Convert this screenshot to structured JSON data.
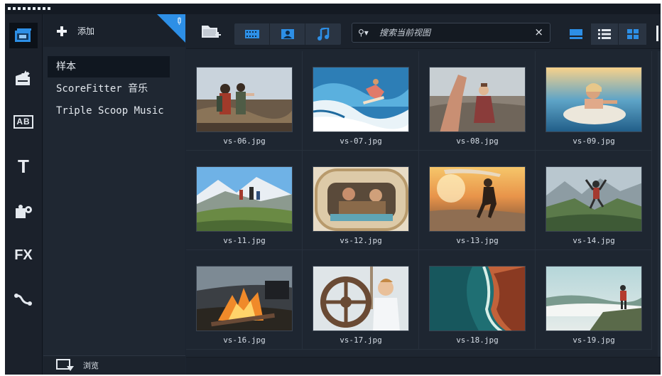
{
  "sidebar_rail": {
    "items": [
      {
        "name": "media-library",
        "icon": "media-library-icon",
        "label": ""
      },
      {
        "name": "instant-project",
        "icon": "clapper-icon",
        "label": ""
      },
      {
        "name": "transition",
        "icon": "transition-ab-icon",
        "label": "AB"
      },
      {
        "name": "title",
        "icon": "title-t-icon",
        "label": "T"
      },
      {
        "name": "graphic",
        "icon": "puzzle-icon",
        "label": ""
      },
      {
        "name": "filter",
        "icon": "fx-icon",
        "label": "FX"
      },
      {
        "name": "path",
        "icon": "path-icon",
        "label": ""
      }
    ]
  },
  "library": {
    "add_label": "添加",
    "browse_label": "浏览",
    "items": [
      {
        "label": "样本",
        "selected": true
      },
      {
        "label": "ScoreFitter 音乐",
        "selected": false
      },
      {
        "label": "Triple Scoop Music",
        "selected": false
      }
    ]
  },
  "toolbar": {
    "search_placeholder": "搜索当前视图",
    "search_value": "",
    "search_clear": "×",
    "filters": [
      "video-filter-icon",
      "photo-filter-icon",
      "audio-filter-icon"
    ],
    "views": [
      "thumbnail-view-icon",
      "list-view-icon",
      "grid-view-icon"
    ]
  },
  "colors": {
    "accent": "#2d8fe6",
    "panel": "#1e2631",
    "rail": "#1b212b"
  },
  "thumbnails": [
    {
      "file": "vs-06.jpg",
      "scene": "hikers"
    },
    {
      "file": "vs-07.jpg",
      "scene": "surfer"
    },
    {
      "file": "vs-08.jpg",
      "scene": "hands"
    },
    {
      "file": "vs-09.jpg",
      "scene": "surfboard"
    },
    {
      "file": "vs-11.jpg",
      "scene": "mountain-hike"
    },
    {
      "file": "vs-12.jpg",
      "scene": "van"
    },
    {
      "file": "vs-13.jpg",
      "scene": "beach-run"
    },
    {
      "file": "vs-14.jpg",
      "scene": "valley-jump"
    },
    {
      "file": "vs-16.jpg",
      "scene": "campfire"
    },
    {
      "file": "vs-17.jpg",
      "scene": "ship-wheel"
    },
    {
      "file": "vs-18.jpg",
      "scene": "aerial-coast"
    },
    {
      "file": "vs-19.jpg",
      "scene": "cliff-view"
    }
  ]
}
